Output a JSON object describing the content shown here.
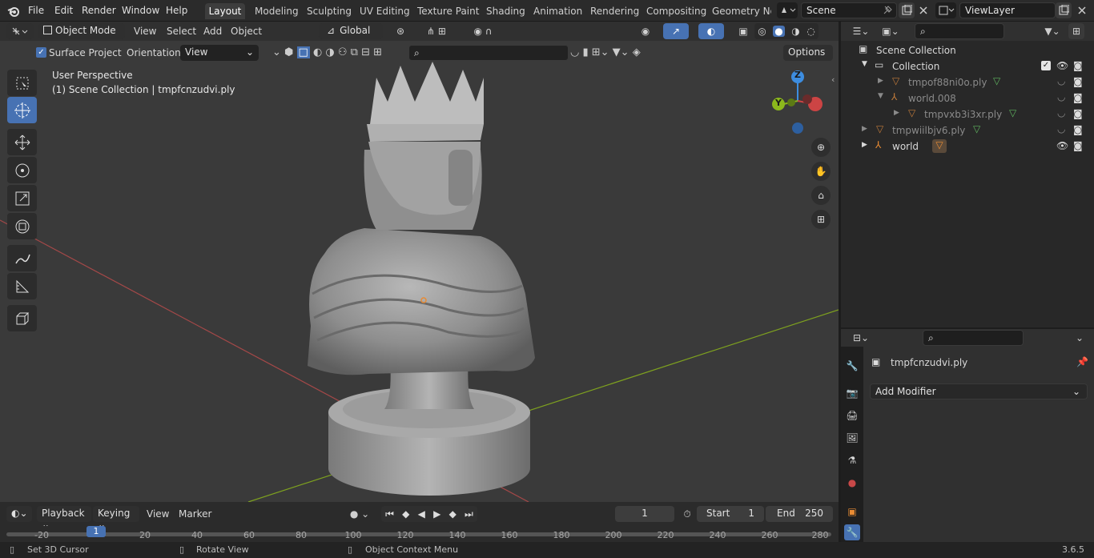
{
  "menu": [
    "File",
    "Edit",
    "Render",
    "Window",
    "Help"
  ],
  "workspaces": [
    "Layout",
    "Modeling",
    "Sculpting",
    "UV Editing",
    "Texture Paint",
    "Shading",
    "Animation",
    "Rendering",
    "Compositing",
    "Geometry Noc"
  ],
  "scene": {
    "label": "Scene",
    "viewlayer": "ViewLayer"
  },
  "viewport": {
    "mode": "Object Mode",
    "menus": [
      "View",
      "Select",
      "Add",
      "Object"
    ],
    "transform_orientation": "Global",
    "surface_project": "Surface Project",
    "orientation_label": "Orientation:",
    "orientation_value": "View",
    "options": "Options",
    "overlay_line1": "User Perspective",
    "overlay_line2": "(1) Scene Collection | tmpfcnzudvi.ply",
    "gizmo": {
      "z": "Z",
      "y": "Y"
    }
  },
  "outliner": {
    "rows": [
      {
        "label": "Scene Collection"
      },
      {
        "label": "Collection"
      },
      {
        "label": "tmpof88ni0o.ply"
      },
      {
        "label": "world.008"
      },
      {
        "label": "tmpvxb3i3xr.ply"
      },
      {
        "label": "tmpwiilbjv6.ply"
      },
      {
        "label": "world"
      }
    ]
  },
  "properties": {
    "object_name": "tmpfcnzudvi.ply",
    "add_modifier": "Add Modifier"
  },
  "timeline": {
    "menus": [
      "Playback",
      "Keying",
      "View",
      "Marker"
    ],
    "current_frame": "1",
    "start_label": "Start",
    "start": "1",
    "end_label": "End",
    "end": "250",
    "ticks": [
      "-20",
      "1",
      "20",
      "40",
      "60",
      "80",
      "100",
      "120",
      "140",
      "160",
      "180",
      "200",
      "220",
      "240",
      "260",
      "280"
    ],
    "playhead": "1"
  },
  "status": {
    "left": "Set 3D Cursor",
    "middle": "Rotate View",
    "right": "Object Context Menu",
    "version": "3.6.5"
  },
  "colors": {
    "accent": "#4772b3",
    "x_axis": "#cc4444",
    "y_axis": "#8cb81c",
    "z_axis": "#3d8de0",
    "mesh_orange": "#e88b33"
  }
}
